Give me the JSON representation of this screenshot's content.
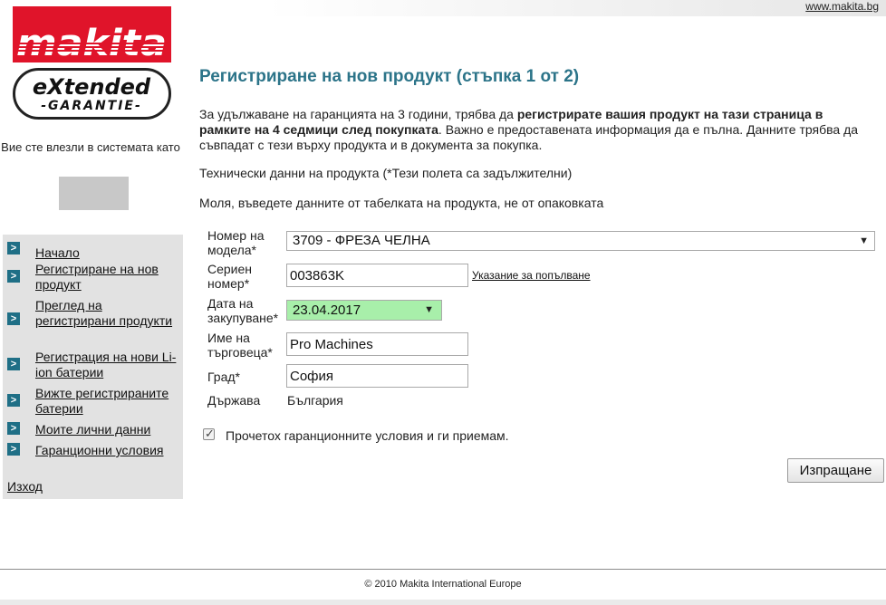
{
  "header": {
    "site_link": "www.makita.bg"
  },
  "sidebar": {
    "logo_text": "makita",
    "badge_line1": "eXtended",
    "badge_line2": "-GARANTIE-",
    "logged_in_text": "Вие сте влезли в системата като",
    "nav": [
      {
        "label": "Начало"
      },
      {
        "label": "Регистриране на нов продукт"
      },
      {
        "label": "Преглед на регистрирани продукти"
      },
      {
        "label": "Регистрация на нови Li-ion батерии"
      },
      {
        "label": "Вижте регистрираните батерии"
      },
      {
        "label": "Моите лични данни"
      },
      {
        "label": "Гаранционни условия"
      }
    ],
    "logout_label": "Изход"
  },
  "main": {
    "title": "Регистриране на нов продукт (стъпка 1 от 2)",
    "intro_part1": "За удължаване на гаранцията на 3 години, трябва да ",
    "intro_bold": "регистрирате вашия продукт на тази страница в рамките на 4 седмици след покупката",
    "intro_part2": ". Важно е предоставената информация да е пълна. Данните трябва да съвпадат с тези върху продукта и в документа за покупка.",
    "tech_label": "Технически данни на продукта (*Тези полета са задължителни)",
    "enter_label": "Моля, въведете данните от табелката на продукта, не от опаковката",
    "form": {
      "model_label": "Номер на модела*",
      "model_value": "3709 - ФРЕЗА ЧЕЛНА",
      "serial_label": "Сериен номер*",
      "serial_value": "003863K",
      "hint_link": "Указание за попълване",
      "date_label": "Дата на закупуване*",
      "date_value": "23.04.2017",
      "dealer_label": "Име на търговеца*",
      "dealer_value": "Pro Machines",
      "city_label": "Град*",
      "city_value": "София",
      "country_label": "Държава",
      "country_value": "България",
      "agree_label": "Прочетох гаранционните условия и ги приемам.",
      "agree_checked": true,
      "submit_label": "Изпращане"
    }
  },
  "footer": {
    "copyright": "© 2010 Makita International Europe"
  },
  "colors": {
    "brand_red": "#e0142a",
    "title_teal": "#2c7489",
    "nav_arrow": "#1f6f86",
    "date_highlight": "#a8efaa"
  }
}
